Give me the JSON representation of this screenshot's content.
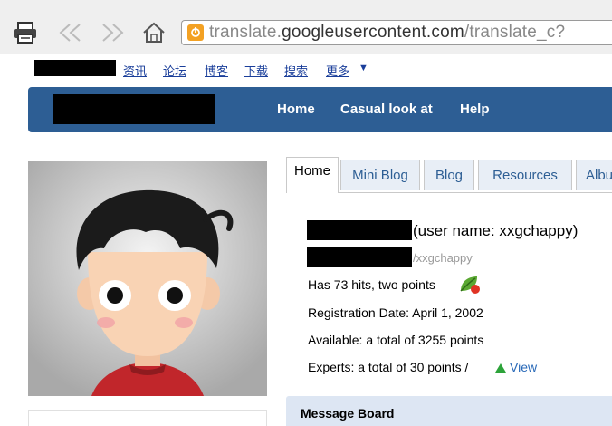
{
  "browser": {
    "url_prefix": "translate.",
    "url_domain": "googleusercontent.com",
    "url_suffix": "/translate_c?"
  },
  "topnav": {
    "links": [
      "资讯",
      "论坛",
      "博客",
      "下载",
      "搜索",
      "更多"
    ],
    "more_arrow": "▼"
  },
  "banner": {
    "nav": [
      "Home",
      "Casual look at",
      "Help"
    ]
  },
  "tabs": [
    "Home",
    "Mini Blog",
    "Blog",
    "Resources",
    "Albu"
  ],
  "profile": {
    "user_name_text": "(user name: xxgchappy)",
    "url_text": "/xxgchappy",
    "hits_text": "Has 73 hits, two points",
    "registration": "Registration Date: April 1, 2002",
    "available": "Available: a total of 3255 points",
    "experts": "Experts: a total of 30 points /",
    "view_link": "View"
  },
  "message_board": {
    "title": "Message Board"
  },
  "colors": {
    "banner": "#2d5e94",
    "link": "#1a3e9a",
    "tab_text": "#2d5e94",
    "view_link": "#2a6ab8"
  }
}
